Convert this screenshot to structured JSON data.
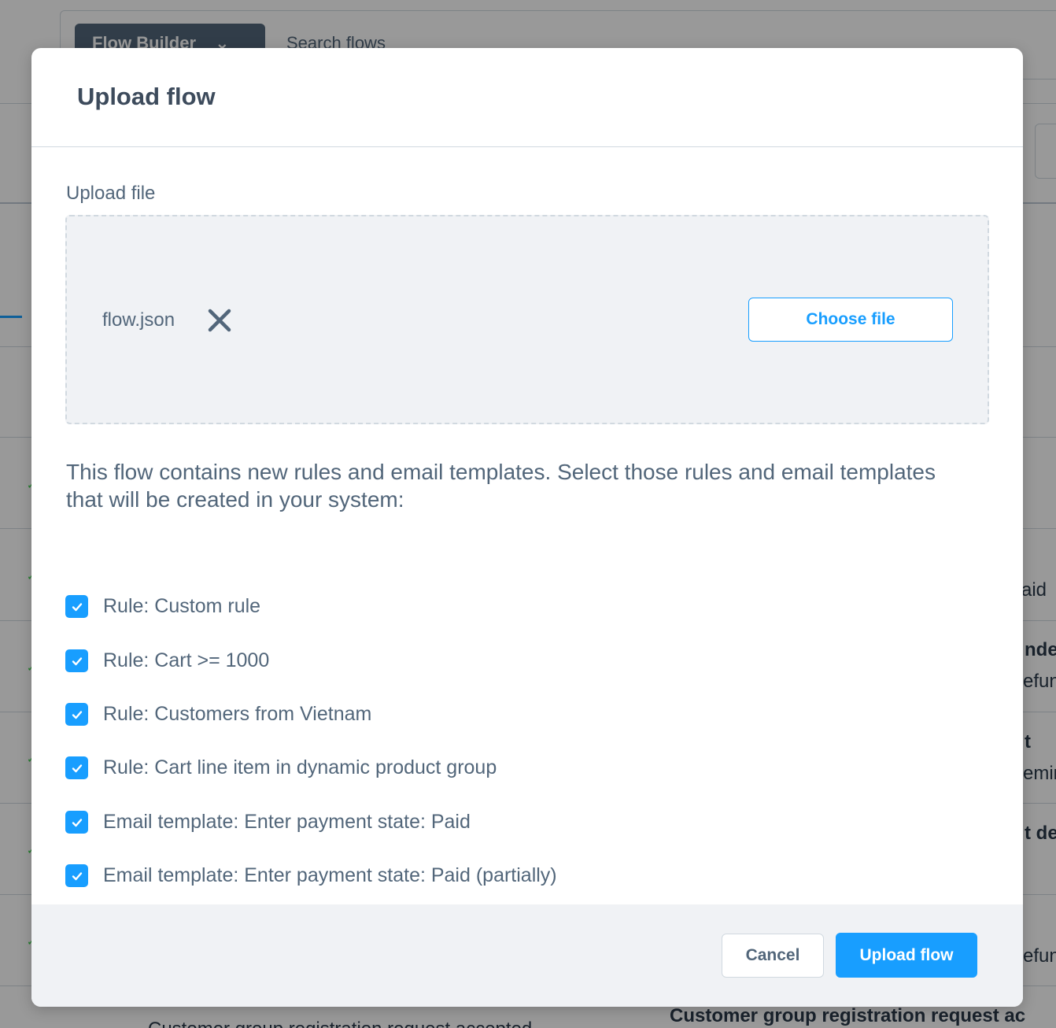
{
  "background": {
    "module_dropdown": "Flow Builder",
    "search_placeholder": "Search flows",
    "right_fragments": [
      "aid",
      "nde",
      "efun",
      "t",
      "emin",
      "t de",
      "efun"
    ],
    "bottom_heading": "Customer group registration request ac",
    "bottom_row": "Customer group registration request accepted"
  },
  "modal": {
    "title": "Upload flow",
    "upload_label": "Upload file",
    "file_name": "flow.json",
    "choose_file": "Choose file",
    "info_text": "This flow contains new rules and email templates. Select those rules and email templates that will be created in your system:",
    "items": [
      {
        "label": "Rule: Custom rule",
        "checked": true
      },
      {
        "label": "Rule: Cart >= 1000",
        "checked": true
      },
      {
        "label": "Rule: Customers from Vietnam",
        "checked": true
      },
      {
        "label": "Rule: Cart line item in dynamic product group",
        "checked": true
      },
      {
        "label": "Email template: Enter payment state: Paid",
        "checked": true
      },
      {
        "label": "Email template: Enter payment state: Paid (partially)",
        "checked": true
      }
    ],
    "cancel": "Cancel",
    "submit": "Upload flow"
  },
  "colors": {
    "primary": "#189eff",
    "text": "#52667a",
    "border": "#d1d9e0",
    "footer_bg": "#f0f2f5"
  }
}
